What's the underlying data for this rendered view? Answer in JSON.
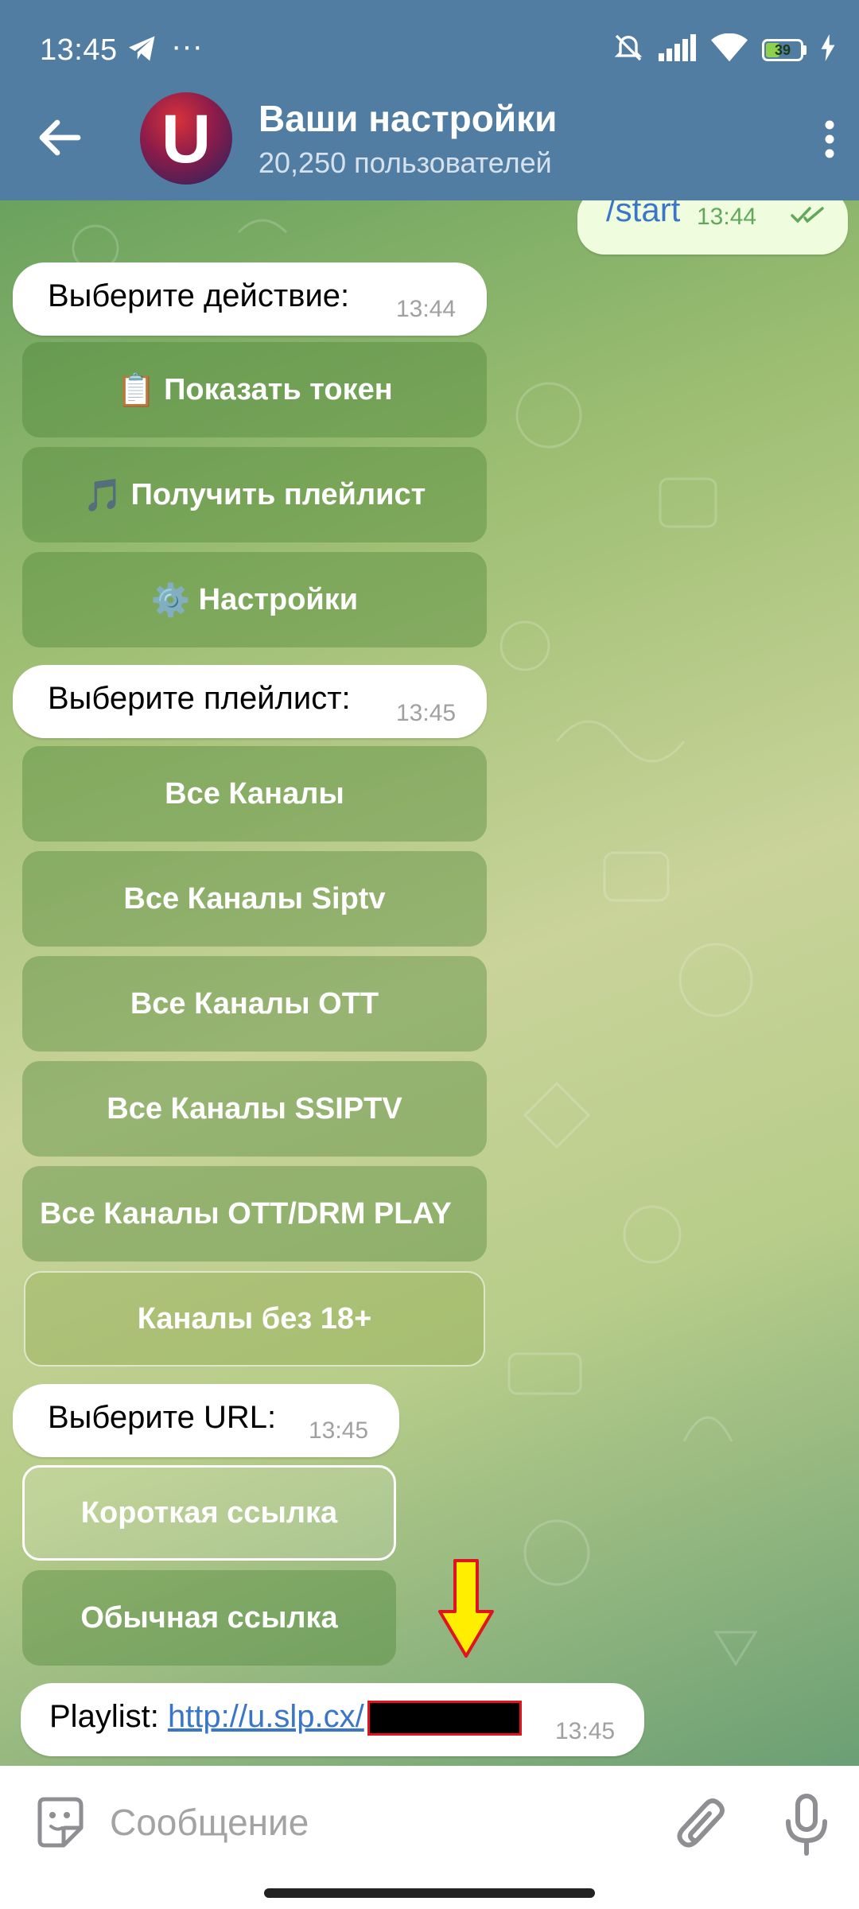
{
  "status": {
    "time": "13:45",
    "dots": "···",
    "battery": "39"
  },
  "header": {
    "title": "Ваши настройки",
    "subtitle": "20,250 пользователей",
    "avatar_letter": "U"
  },
  "chat": {
    "out_message": {
      "text": "/start",
      "time": "13:44"
    },
    "msg1": {
      "text": "Выберите действие:",
      "time": "13:44"
    },
    "actions": [
      {
        "emoji": "📋",
        "label": "Показать токен"
      },
      {
        "emoji": "🎵",
        "label": "Получить плейлист"
      },
      {
        "emoji": "⚙️",
        "label": "Настройки"
      }
    ],
    "msg2": {
      "text": "Выберите плейлист:",
      "time": "13:45"
    },
    "playlists": [
      {
        "label": "Все Каналы"
      },
      {
        "label": "Все Каналы Siptv"
      },
      {
        "label": "Все Каналы OTT"
      },
      {
        "label": "Все Каналы SSIPTV"
      },
      {
        "label": "Все Каналы OTT/DRM PLAY"
      },
      {
        "label": "Каналы без 18+"
      }
    ],
    "msg3": {
      "text": "Выберите URL:",
      "time": "13:45"
    },
    "url_options": [
      {
        "label": "Короткая ссылка"
      },
      {
        "label": "Обычная ссылка"
      }
    ],
    "msg4": {
      "prefix": "Playlist:",
      "link": "http://u.slp.cx/",
      "time": "13:45"
    }
  },
  "input": {
    "placeholder": "Сообщение"
  },
  "colors": {
    "header": "#517da2",
    "link": "#3a76c8",
    "annotation_arrow": "#ffee00",
    "redaction_border": "#e0141c"
  }
}
